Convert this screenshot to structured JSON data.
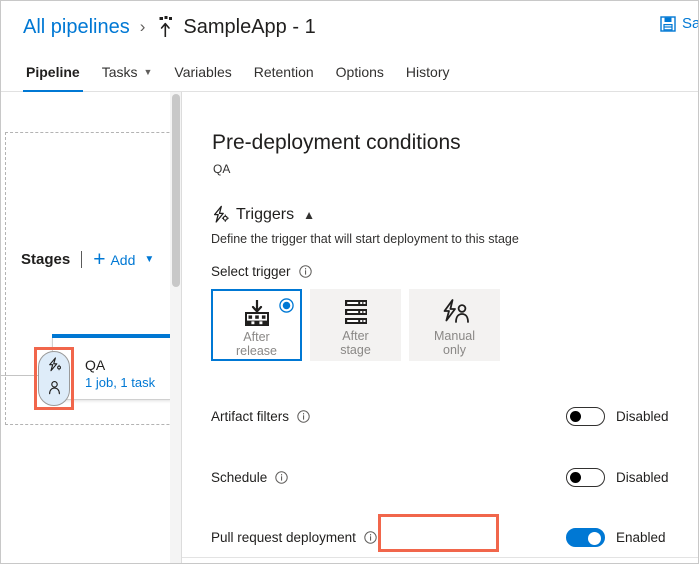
{
  "header": {
    "breadcrumb_root": "All pipelines",
    "breadcrumb_separator": "›",
    "pipeline_icon": "release-pipeline-icon",
    "breadcrumb_current": "SampleApp - 1",
    "save_icon": "save-floppy-icon",
    "save_label": "Save"
  },
  "tabs": [
    {
      "label": "Pipeline",
      "active": true,
      "has_caret": false
    },
    {
      "label": "Tasks",
      "active": false,
      "has_caret": true
    },
    {
      "label": "Variables",
      "active": false,
      "has_caret": false
    },
    {
      "label": "Retention",
      "active": false,
      "has_caret": false
    },
    {
      "label": "Options",
      "active": false,
      "has_caret": false
    },
    {
      "label": "History",
      "active": false,
      "has_caret": false
    }
  ],
  "stages_panel": {
    "title": "Stages",
    "add_label": "Add",
    "add_caret": "⌄",
    "plus_glyph": "+",
    "stage": {
      "name": "QA",
      "meta": "1 job, 1 task",
      "pre_deploy_icon": "pre-deployment-trigger-icon",
      "post_deploy_icon": "approval-person-icon"
    }
  },
  "content": {
    "page_title": "Pre-deployment conditions",
    "page_subtitle": "QA",
    "section": {
      "icon": "triggers-icon",
      "title": "Triggers",
      "chevron": "⌃",
      "description": "Define the trigger that will start deployment to this stage"
    },
    "select_trigger": {
      "label": "Select trigger",
      "info_icon": "info-icon",
      "options": [
        {
          "label_line1": "After",
          "label_line2": "release",
          "icon": "after-release-icon",
          "selected": true
        },
        {
          "label_line1": "After",
          "label_line2": "stage",
          "icon": "after-stage-icon",
          "selected": false
        },
        {
          "label_line1": "Manual",
          "label_line2": "only",
          "icon": "manual-only-icon",
          "selected": false
        }
      ]
    },
    "toggles": [
      {
        "label": "Artifact filters",
        "info_icon": "info-icon",
        "state_label": "Disabled",
        "enabled": false
      },
      {
        "label": "Schedule",
        "info_icon": "info-icon",
        "state_label": "Disabled",
        "enabled": false
      },
      {
        "label": "Pull request deployment",
        "info_icon": "info-icon",
        "state_label": "Enabled",
        "enabled": true
      }
    ]
  },
  "annotations": {
    "stage_highlight": "red-highlight-box",
    "toggle_highlight": "red-highlight-box",
    "color": "#f1664b"
  },
  "colors": {
    "accent": "#0078d4",
    "text": "#201f1e",
    "muted": "#8a8886",
    "card_bg": "#f3f2f1",
    "stage_pill_bg": "#deecf9",
    "highlight": "#f1664b"
  }
}
